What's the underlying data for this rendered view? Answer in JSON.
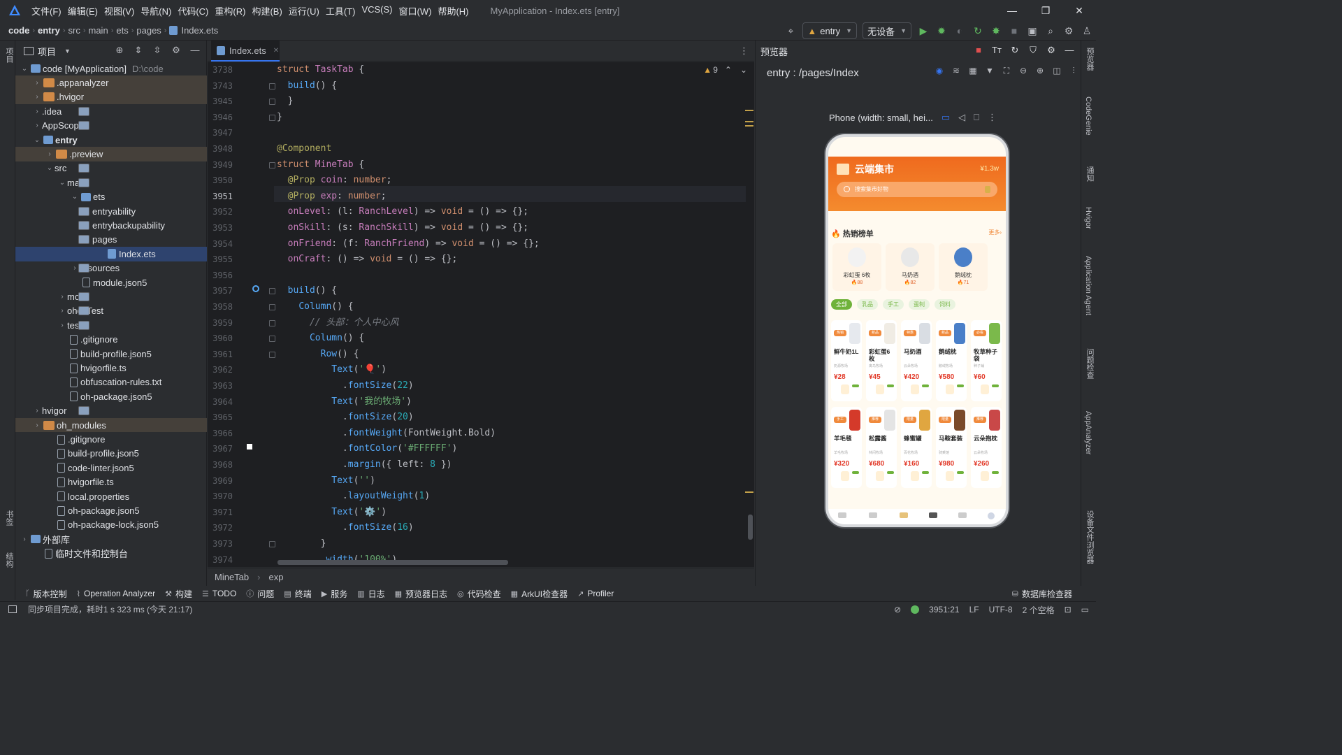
{
  "menu": [
    "文件(F)",
    "编辑(E)",
    "视图(V)",
    "导航(N)",
    "代码(C)",
    "重构(R)",
    "构建(B)",
    "运行(U)",
    "工具(T)",
    "VCS(S)",
    "窗口(W)",
    "帮助(H)"
  ],
  "window_title": "MyApplication - Index.ets [entry]",
  "breadcrumb": [
    "code",
    "entry",
    "src",
    "main",
    "ets",
    "pages",
    "Index.ets"
  ],
  "run_config": "entry",
  "device": "无设备",
  "project_panel": {
    "title": "项目",
    "items": [
      {
        "label": "code [MyApplication]",
        "extra": "D:\\code",
        "depth": 0,
        "open": true,
        "kind": "lib"
      },
      {
        "label": ".appanalyzer",
        "depth": 1,
        "open": false,
        "kind": "ofold",
        "hl": true
      },
      {
        "label": ".hvigor",
        "depth": 1,
        "open": false,
        "kind": "ofold",
        "hl": true
      },
      {
        "label": ".idea",
        "depth": 1,
        "open": false,
        "kind": "fold"
      },
      {
        "label": "AppScope",
        "depth": 1,
        "open": false,
        "kind": "fold"
      },
      {
        "label": "entry",
        "depth": 1,
        "open": true,
        "kind": "lib",
        "bold": true
      },
      {
        "label": ".preview",
        "depth": 2,
        "open": false,
        "kind": "ofold",
        "hl": true
      },
      {
        "label": "src",
        "depth": 2,
        "open": true,
        "kind": "fold"
      },
      {
        "label": "main",
        "depth": 3,
        "open": true,
        "kind": "fold"
      },
      {
        "label": "ets",
        "depth": 4,
        "open": true,
        "kind": "lib"
      },
      {
        "label": "entryability",
        "depth": 5,
        "open": false,
        "kind": "fold"
      },
      {
        "label": "entrybackupability",
        "depth": 5,
        "open": false,
        "kind": "fold"
      },
      {
        "label": "pages",
        "depth": 5,
        "open": true,
        "kind": "fold"
      },
      {
        "label": "Index.ets",
        "depth": 6,
        "kind": "ets",
        "sel": true
      },
      {
        "label": "resources",
        "depth": 4,
        "open": false,
        "kind": "fold"
      },
      {
        "label": "module.json5",
        "depth": 4,
        "kind": "file"
      },
      {
        "label": "mock",
        "depth": 3,
        "open": false,
        "kind": "fold"
      },
      {
        "label": "ohosTest",
        "depth": 3,
        "open": false,
        "kind": "fold"
      },
      {
        "label": "test",
        "depth": 3,
        "open": false,
        "kind": "fold"
      },
      {
        "label": ".gitignore",
        "depth": 3,
        "kind": "file"
      },
      {
        "label": "build-profile.json5",
        "depth": 3,
        "kind": "file"
      },
      {
        "label": "hvigorfile.ts",
        "depth": 3,
        "kind": "file"
      },
      {
        "label": "obfuscation-rules.txt",
        "depth": 3,
        "kind": "file"
      },
      {
        "label": "oh-package.json5",
        "depth": 3,
        "kind": "file"
      },
      {
        "label": "hvigor",
        "depth": 1,
        "open": false,
        "kind": "fold"
      },
      {
        "label": "oh_modules",
        "depth": 1,
        "open": false,
        "kind": "ofold",
        "hl": true
      },
      {
        "label": ".gitignore",
        "depth": 2,
        "kind": "file"
      },
      {
        "label": "build-profile.json5",
        "depth": 2,
        "kind": "file"
      },
      {
        "label": "code-linter.json5",
        "depth": 2,
        "kind": "file"
      },
      {
        "label": "hvigorfile.ts",
        "depth": 2,
        "kind": "file"
      },
      {
        "label": "local.properties",
        "depth": 2,
        "kind": "file"
      },
      {
        "label": "oh-package.json5",
        "depth": 2,
        "kind": "file"
      },
      {
        "label": "oh-package-lock.json5",
        "depth": 2,
        "kind": "file"
      },
      {
        "label": "外部库",
        "depth": 0,
        "open": false,
        "kind": "lib"
      },
      {
        "label": "临时文件和控制台",
        "depth": 1,
        "kind": "file"
      }
    ]
  },
  "editor": {
    "tab": "Index.ets",
    "warnings": "9",
    "lines": [
      {
        "n": "3738",
        "h": "<span class='k'>struct</span> <span class='ty'>TaskTab</span> {"
      },
      {
        "n": "3743",
        "h": "  <span class='f'>build</span>() {"
      },
      {
        "n": "3945",
        "h": "  }"
      },
      {
        "n": "3946",
        "h": "}"
      },
      {
        "n": "3947",
        "h": ""
      },
      {
        "n": "3948",
        "h": "<span class='a'>@Component</span>"
      },
      {
        "n": "3949",
        "h": "<span class='k'>struct</span> <span class='ty'>MineTab</span> {"
      },
      {
        "n": "3950",
        "h": "  <span class='a'>@Prop</span> <span class='p'>coin</span>: <span class='k'>number</span>;"
      },
      {
        "n": "3951",
        "h": "  <span class='a'>@Prop</span> <span class='p'>exp</span>: <span class='k'>number</span>;"
      },
      {
        "n": "3952",
        "h": "  <span class='p'>onLevel</span>: (l: <span class='ty'>RanchLevel</span>) => <span class='k'>void</span> = () => {};"
      },
      {
        "n": "3953",
        "h": "  <span class='p'>onSkill</span>: (s: <span class='ty'>RanchSkill</span>) => <span class='k'>void</span> = () => {};"
      },
      {
        "n": "3954",
        "h": "  <span class='p'>onFriend</span>: (f: <span class='ty'>RanchFriend</span>) => <span class='k'>void</span> = () => {};"
      },
      {
        "n": "3955",
        "h": "  <span class='p'>onCraft</span>: () => <span class='k'>void</span> = () => {};"
      },
      {
        "n": "3956",
        "h": ""
      },
      {
        "n": "3957",
        "h": "  <span class='f'>build</span>() {"
      },
      {
        "n": "3958",
        "h": "    <span class='f'>Column</span>() {"
      },
      {
        "n": "3959",
        "h": "      <span class='c'>// 头部：个人中心风</span>"
      },
      {
        "n": "3960",
        "h": "      <span class='f'>Column</span>() {"
      },
      {
        "n": "3961",
        "h": "        <span class='f'>Row</span>() {"
      },
      {
        "n": "3962",
        "h": "          <span class='f'>Text</span>(<span class='s'>'🎈'</span>)"
      },
      {
        "n": "3963",
        "h": "            .<span class='f'>fontSize</span>(<span class='n'>22</span>)"
      },
      {
        "n": "3964",
        "h": "          <span class='f'>Text</span>(<span class='s'>'我的牧场'</span>)"
      },
      {
        "n": "3965",
        "h": "            .<span class='f'>fontSize</span>(<span class='n'>20</span>)"
      },
      {
        "n": "3966",
        "h": "            .<span class='f'>fontWeight</span>(FontWeight.Bold)"
      },
      {
        "n": "3967",
        "h": "            .<span class='f'>fontColor</span>(<span class='s'>'#FFFFFF'</span>)"
      },
      {
        "n": "3968",
        "h": "            .<span class='f'>margin</span>({ left: <span class='n'>8</span> })"
      },
      {
        "n": "3969",
        "h": "          <span class='f'>Text</span>(<span class='s'>''</span>)"
      },
      {
        "n": "3970",
        "h": "            .<span class='f'>layoutWeight</span>(<span class='n'>1</span>)"
      },
      {
        "n": "3971",
        "h": "          <span class='f'>Text</span>(<span class='s'>'⚙️'</span>)"
      },
      {
        "n": "3972",
        "h": "            .<span class='f'>fontSize</span>(<span class='n'>16</span>)"
      },
      {
        "n": "3973",
        "h": "        }"
      },
      {
        "n": "3974",
        "h": "        .<span class='f'>width</span>(<span class='s'>'100%'</span>)"
      }
    ],
    "footer_crumbs": [
      "MineTab",
      "exp"
    ]
  },
  "previewer": {
    "title": "预览器",
    "path": "entry : /pages/Index",
    "device_label": "Phone (width: small, hei...",
    "app": {
      "title": "云端集市",
      "balance": "¥1.3w",
      "search_placeholder": "搜索集市好物",
      "hot_title": "热销榜单",
      "hot_more": "更多›",
      "hot_items": [
        {
          "name": "彩虹蛋 6枚",
          "heat": "🔥88"
        },
        {
          "name": "马奶酒",
          "heat": "🔥82"
        },
        {
          "name": "鹅绒枕",
          "heat": "🔥71"
        }
      ],
      "chips": [
        "全部",
        "乳品",
        "手工",
        "蛋制",
        "饲料"
      ],
      "products": [
        {
          "badge": "热销",
          "name": "鲜牛奶1L",
          "sub": "奶源牧场",
          "price": "¥28"
        },
        {
          "badge": "新品",
          "name": "彩虹蛋6枚",
          "sub": "禽鸟牧场",
          "price": "¥45"
        },
        {
          "badge": "特惠",
          "name": "马奶酒",
          "sub": "云朵牧场",
          "price": "¥420"
        },
        {
          "badge": "新品",
          "name": "鹅绒枕",
          "sub": "鹅绒牧场",
          "price": "¥580"
        },
        {
          "badge": "必看",
          "name": "牧草种子袋",
          "sub": "种子铺",
          "price": "¥60"
        },
        {
          "badge": "手工",
          "name": "羊毛毯",
          "sub": "羊毛牧场",
          "price": "¥320"
        },
        {
          "badge": "推荐",
          "name": "松露酱",
          "sub": "林间牧场",
          "price": "¥680"
        },
        {
          "badge": "限量",
          "name": "蜂蜜罐",
          "sub": "百花牧场",
          "price": "¥160"
        },
        {
          "badge": "限量",
          "name": "马鞍套装",
          "sub": "骑乘馆",
          "price": "¥980"
        },
        {
          "badge": "推荐",
          "name": "云朵抱枕",
          "sub": "云朵牧场",
          "price": "¥260"
        }
      ]
    }
  },
  "bottom_tools": [
    "版本控制",
    "Operation Analyzer",
    "构建",
    "TODO",
    "问题",
    "终端",
    "服务",
    "日志",
    "预览器日志",
    "代码检查",
    "ArkUI检查器",
    "Profiler"
  ],
  "bottom_right_tool": "数据库检查器",
  "left_strip": [
    "项目",
    "书签",
    "结构"
  ],
  "right_strip": [
    "预览器",
    "CodeGenie",
    "通知",
    "Hvigor",
    "Application Agent",
    "问题检查",
    "AppAnalyzer",
    "设备文件浏览器"
  ],
  "status": {
    "message": "同步项目完成，耗时1 s 323 ms (今天 21:17)",
    "position": "3951:21",
    "line_ending": "LF",
    "encoding": "UTF-8",
    "indent": "2 个空格"
  },
  "colors": {
    "accent": "#3574f0",
    "orange": "#ef6a1e",
    "selection": "#2e436e"
  }
}
